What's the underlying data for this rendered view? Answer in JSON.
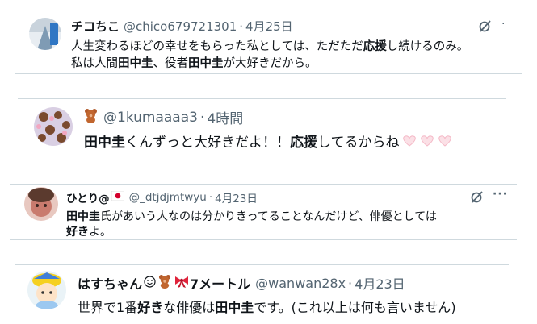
{
  "tweets": [
    {
      "name": "チコちこ",
      "handle": "@chico679721301",
      "date": "4月25日",
      "lines": [
        [
          {
            "t": "人生変わるほどの幸せをもらった私としては、ただただ"
          },
          {
            "t": "応援",
            "b": true
          },
          {
            "t": "し続けるのみ。"
          }
        ],
        [
          {
            "t": "私は人間"
          },
          {
            "t": "田中圭",
            "b": true
          },
          {
            "t": "、役者"
          },
          {
            "t": "田中圭",
            "b": true
          },
          {
            "t": "が大好きだから。"
          }
        ]
      ]
    },
    {
      "name": "",
      "handle": "@1kumaaaa3",
      "date": "4時間",
      "lines": [
        [
          {
            "t": "田中圭",
            "b": true
          },
          {
            "t": "くんずっと大好きだよ！！"
          },
          {
            "t": "応援",
            "b": true
          },
          {
            "t": "してるからね"
          }
        ]
      ]
    },
    {
      "name": "ひとり@",
      "handle": "@_dtjdjmtwyu",
      "date": "4月23日",
      "lines": [
        [
          {
            "t": "田中圭",
            "b": true
          },
          {
            "t": "氏があいう人なのは分かりきってることなんだけど、俳優としては"
          }
        ],
        [
          {
            "t": "好き",
            "b": true
          },
          {
            "t": "よ。"
          }
        ]
      ]
    },
    {
      "name_a": "はすちゃん",
      "name_b": "7メートル",
      "handle": "@wanwan28x",
      "date": "4月23日",
      "lines": [
        [
          {
            "t": "世界で1番"
          },
          {
            "t": "好き",
            "b": true
          },
          {
            "t": "な俳優は"
          },
          {
            "t": "田中圭",
            "b": true
          },
          {
            "t": "です。(これ以上は何も言いません)"
          }
        ]
      ]
    }
  ],
  "icons": [
    "grok-icon",
    "more-icon",
    "bear-emoji-icon",
    "heart-emoji-icon",
    "japan-flag-icon",
    "smile-emoji-icon",
    "ribbon-emoji-icon"
  ],
  "colors": {
    "text": "#0f1419",
    "muted": "#536471",
    "divider": "#cfd9de"
  }
}
